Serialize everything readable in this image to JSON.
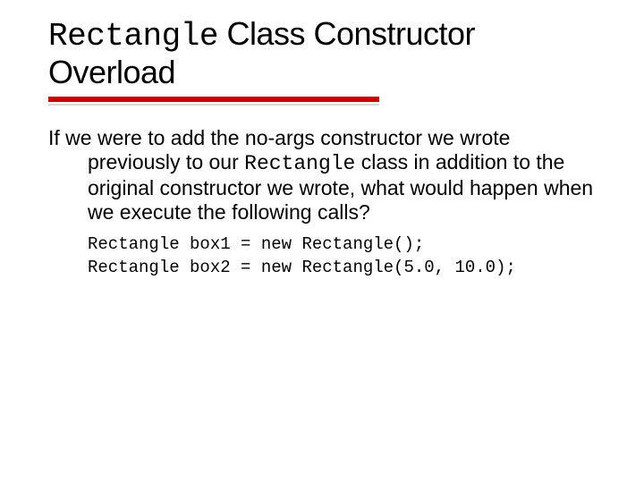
{
  "title": {
    "word1_mono": "Rectangle",
    "rest": " Class Constructor Overload"
  },
  "body": {
    "para_pre": "If we were to add the no-args constructor we wrote previously to our ",
    "para_mono": "Rectangle",
    "para_post": " class in addition to the original constructor we wrote, what would happen when we execute the following calls?"
  },
  "code": {
    "line1": "Rectangle box1 = new Rectangle();",
    "line2": "Rectangle box2 = new Rectangle(5.0, 10.0);"
  }
}
